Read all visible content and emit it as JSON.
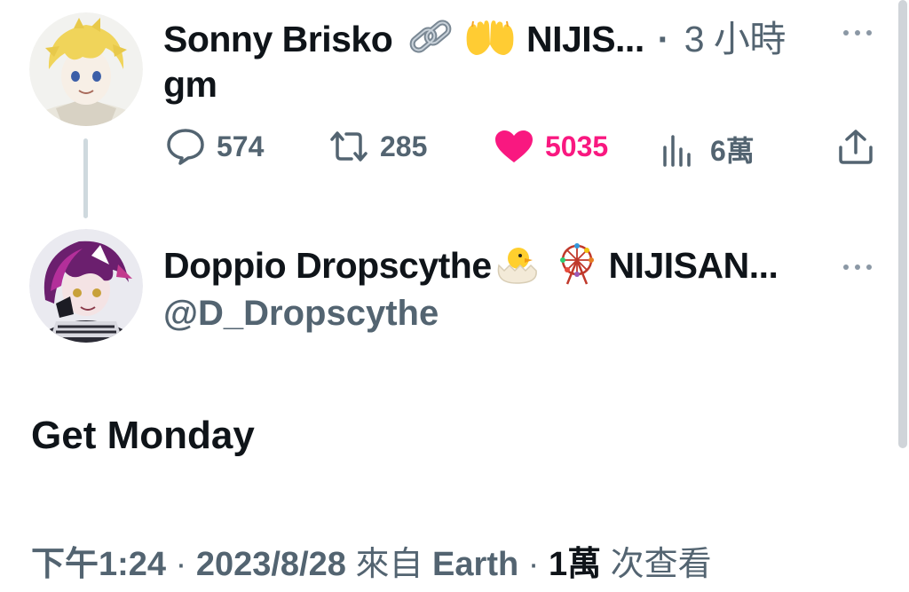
{
  "reply_parent": {
    "display_name": "Sonny Brisko",
    "name_suffix": "NIJIS...",
    "separator": "·",
    "time_ago": "3 小時",
    "text": "gm",
    "stats": {
      "replies": "574",
      "retweets": "285",
      "likes": "5035",
      "views": "6萬"
    }
  },
  "main_tweet": {
    "display_name": "Doppio Dropscythe",
    "name_suffix": "NIJISAN...",
    "handle": "@D_Dropscythe",
    "text": "Get Monday",
    "meta": {
      "time": "下午1:24",
      "sep1": "·",
      "date": "2023/8/28",
      "source_prefix": "來自",
      "source": "Earth",
      "sep2": "·",
      "views_count": "1萬",
      "views_suffix": "次查看"
    }
  },
  "icons": {
    "reply": "speech-bubble-icon",
    "retweet": "retweet-icon",
    "like": "heart-icon",
    "views": "bar-chart-icon",
    "share": "share-icon",
    "more": "more-dots-icon",
    "chain": "chain-link-emoji",
    "hands": "raised-hands-emoji",
    "chick": "hatching-chick-emoji",
    "ferris": "ferris-wheel-emoji"
  },
  "colors": {
    "like": "#f91880",
    "muted": "#536471",
    "text": "#0f1419"
  }
}
